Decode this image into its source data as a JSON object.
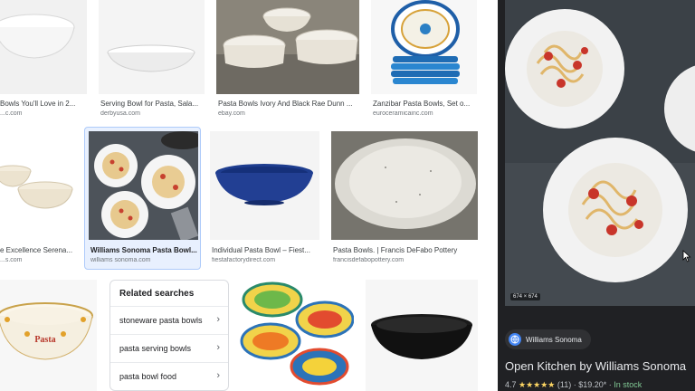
{
  "results": [
    {
      "title": "Bowls You'll Love in 2...",
      "source": "...c.com"
    },
    {
      "title": "Serving Bowl for Pasta, Sala...",
      "source": "derbyusa.com"
    },
    {
      "title": "Pasta Bowls Ivory And Black Rae Dunn ...",
      "source": "ebay.com"
    },
    {
      "title": "Zanzibar Pasta Bowls, Set o...",
      "source": "euroceramicainc.com"
    },
    {
      "title": "e Excellence Serena...",
      "source": "...s.com"
    },
    {
      "title": "Williams Sonoma Pasta Bowl...",
      "source": "williams sonoma.com"
    },
    {
      "title": "Individual Pasta Bowl – Fiest...",
      "source": "fiestafactorydirect.com"
    },
    {
      "title": "Pasta Bowls. | Francis DeFabo Pottery",
      "source": "francisdefabopottery.com"
    }
  ],
  "related": {
    "title": "Related searches",
    "items": [
      "stoneware pasta bowls",
      "pasta serving bowls",
      "pasta bowl food"
    ]
  },
  "bowl_text": "Pasta",
  "panel": {
    "dimensions": "674 × 674",
    "source_name": "Williams Sonoma",
    "title": "Open Kitchen by Williams Sonoma",
    "rating": "4.7",
    "stars": "★★★★★",
    "reviews": "(11)",
    "price": "$19.20*",
    "stock": "In stock"
  },
  "colors": {
    "accent": "#1a73e8",
    "panel_bg": "#202124",
    "in_stock": "#81c995"
  }
}
